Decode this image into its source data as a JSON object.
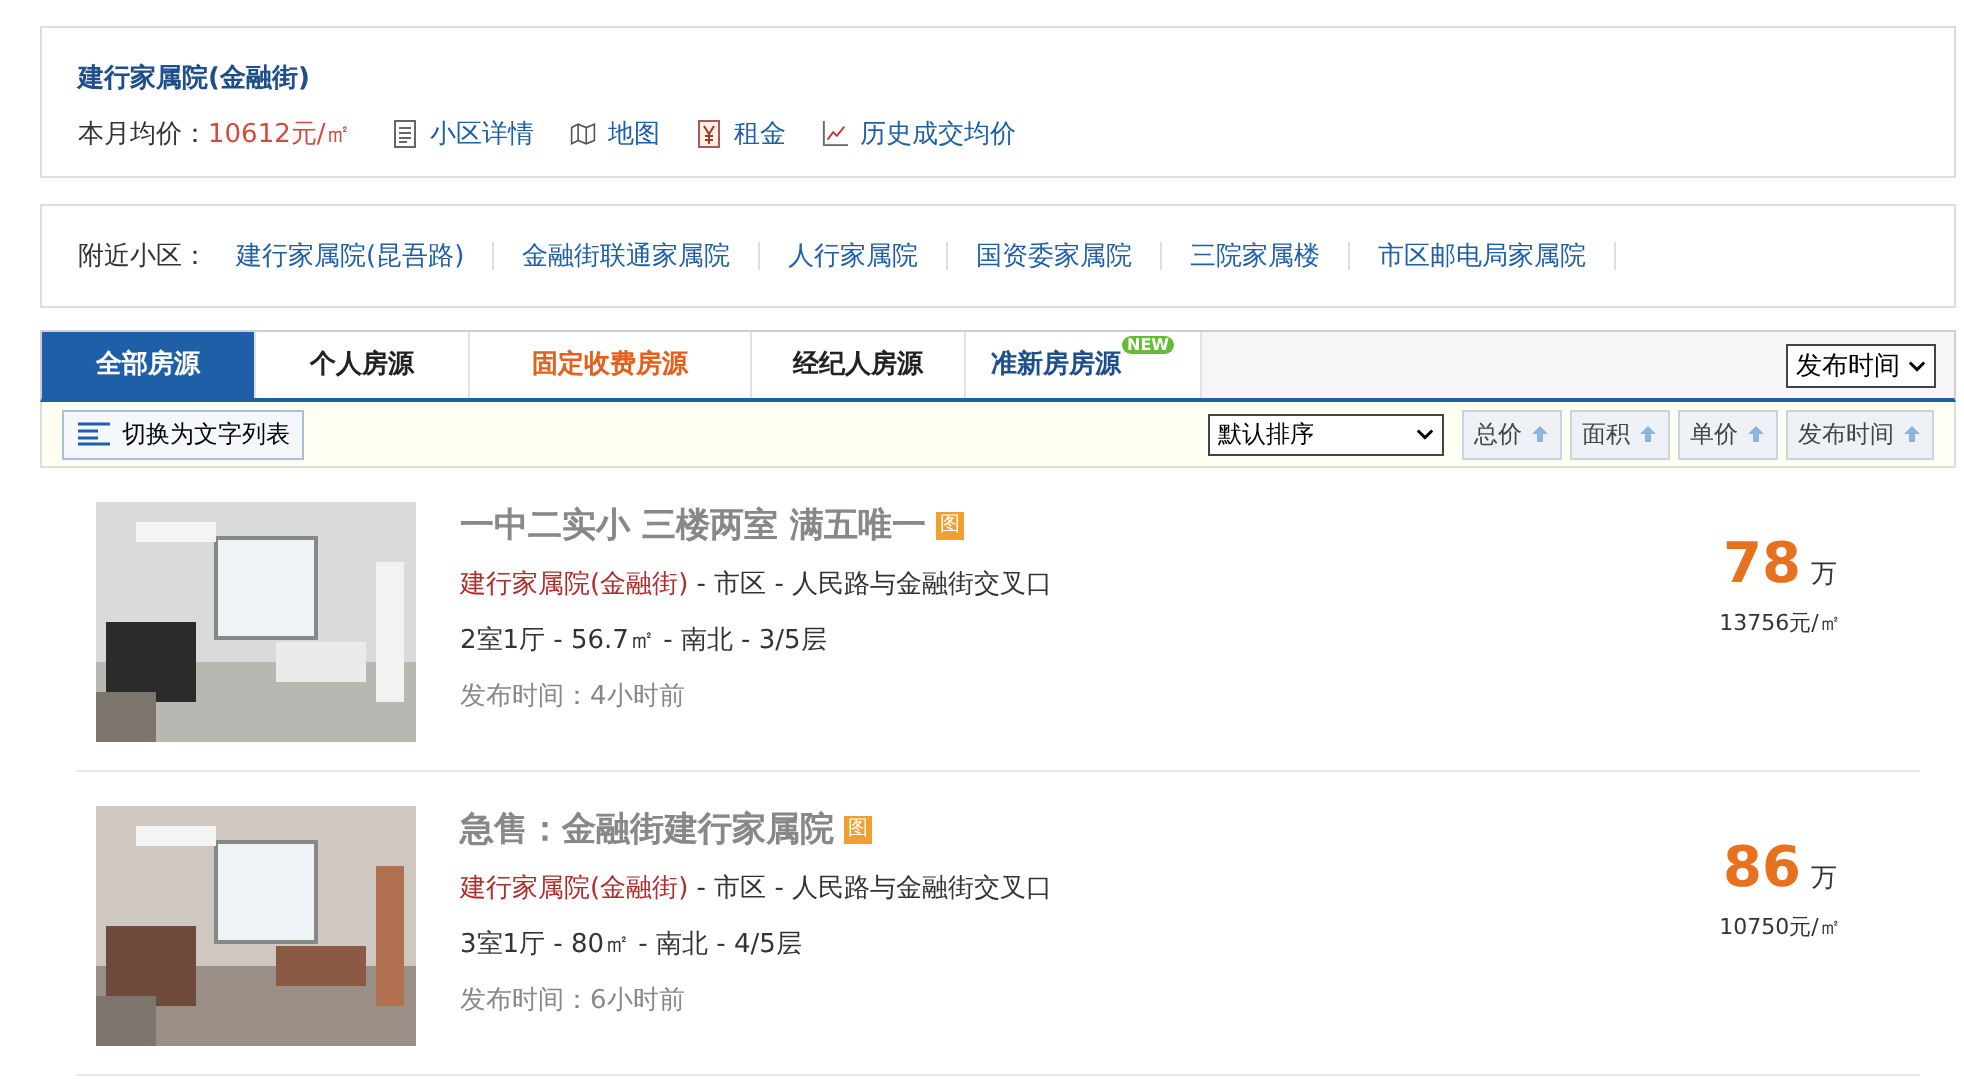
{
  "community": {
    "name": "建行家属院(金融街)",
    "price_label": "本月均价：",
    "price": "10612元/㎡",
    "links": [
      {
        "kind": "doc",
        "label": "小区详情"
      },
      {
        "kind": "map",
        "label": "地图"
      },
      {
        "kind": "rent",
        "label": "租金"
      },
      {
        "kind": "chart",
        "label": "历史成交均价"
      }
    ]
  },
  "nearby": {
    "label": "附近小区：",
    "items": [
      "建行家属院(昆吾路)",
      "金融街联通家属院",
      "人行家属院",
      "国资委家属院",
      "三院家属楼",
      "市区邮电局家属院"
    ]
  },
  "tabs": [
    {
      "label": "全部房源",
      "selected": true,
      "kind": "plain"
    },
    {
      "label": "个人房源",
      "selected": false,
      "kind": "plain"
    },
    {
      "label": "固定收费房源",
      "selected": false,
      "kind": "hot"
    },
    {
      "label": "经纪人房源",
      "selected": false,
      "kind": "plain"
    },
    {
      "label": "准新房房源",
      "selected": false,
      "kind": "new",
      "badge": "NEW"
    }
  ],
  "tab_select": "发布时间",
  "toolbar": {
    "switch_label": "切换为文字列表",
    "sort_select": "默认排序",
    "sort_buttons": [
      "总价",
      "面积",
      "单价",
      "发布时间"
    ]
  },
  "listings": [
    {
      "kind": "picture",
      "title": "一中二实小 三楼两室 满五唯一",
      "badge": "图",
      "community": "建行家属院(金融街)",
      "location": " - 市区 - 人民路与金融街交叉口",
      "details": "2室1厅 - 56.7㎡ - 南北 - 3/5层",
      "posted": "发布时间：4小时前",
      "price": "78",
      "unit": "万",
      "unit_price": "13756元/㎡"
    },
    {
      "kind": "picture",
      "title": "急售：金融街建行家属院",
      "badge": "图",
      "community": "建行家属院(金融街)",
      "location": " - 市区 - 人民路与金融街交叉口",
      "details": "3室1厅 - 80㎡ - 南北 - 4/5层",
      "posted": "发布时间：6小时前",
      "price": "86",
      "unit": "万",
      "unit_price": "10750元/㎡"
    }
  ]
}
